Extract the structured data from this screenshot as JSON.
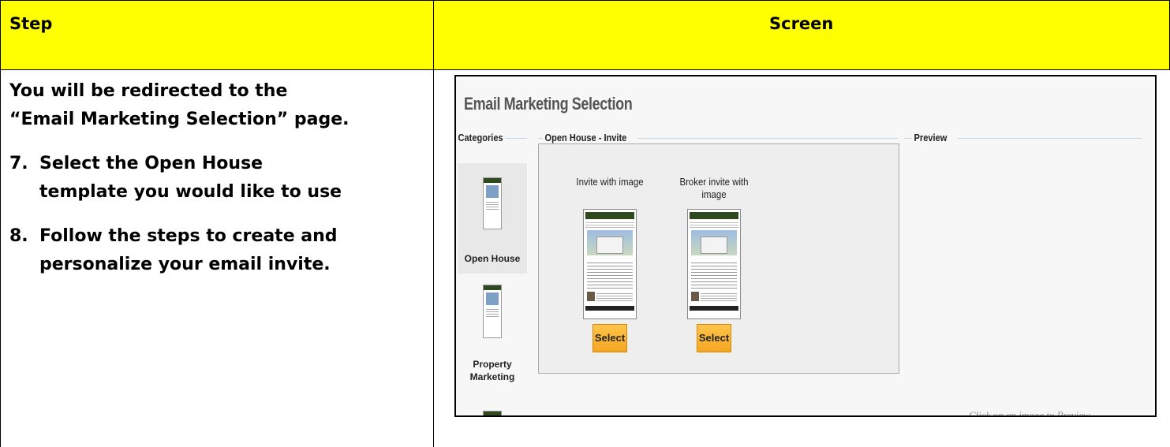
{
  "table": {
    "header_step": "Step",
    "header_screen": "Screen",
    "intro_line1": "You will be redirected to the",
    "intro_line2": "“Email Marketing Selection” page.",
    "step7_num": "7.",
    "step7_line1": "Select the Open House",
    "step7_line2": "template you would like to use",
    "step8_num": "8.",
    "step8_line1": "Follow the steps to create and",
    "step8_line2": "personalize your email invite.",
    "header_color": "#ffff00"
  },
  "screen": {
    "title": "Email Marketing Selection",
    "categories_legend": "Categories",
    "panel_legend": "Open House - Invite",
    "preview_legend": "Preview",
    "categories": [
      {
        "label": "Open House",
        "selected": true
      },
      {
        "label_line1": "Property",
        "label_line2": "Marketing",
        "selected": false
      }
    ],
    "templates": [
      {
        "label": "Invite with image",
        "button": "Select"
      },
      {
        "label_line1": "Broker invite with",
        "label_line2": "image",
        "button": "Select"
      }
    ],
    "preview_hint": "Click on an image to Preview",
    "button_color": "#f5a623"
  }
}
